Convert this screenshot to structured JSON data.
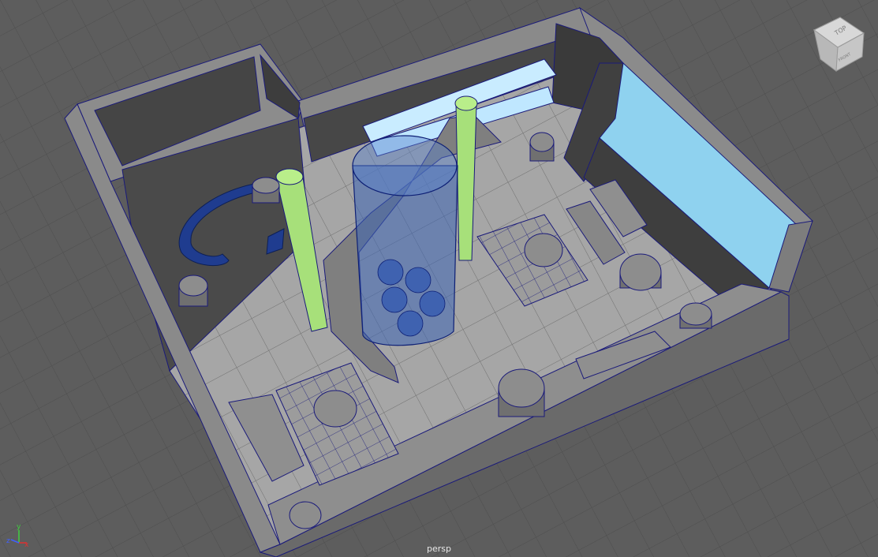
{
  "viewport": {
    "camera_name": "persp",
    "background_color": "#5d5d5d",
    "wireframe_color": "#1a1a7a"
  },
  "view_cube": {
    "top_label": "TOP",
    "front_label": "FRONT"
  },
  "axis_gizmo": {
    "x_label": "x",
    "y_label": "y",
    "z_label": "z",
    "x_color": "#e03030",
    "y_color": "#40d040",
    "z_color": "#4060ff"
  }
}
